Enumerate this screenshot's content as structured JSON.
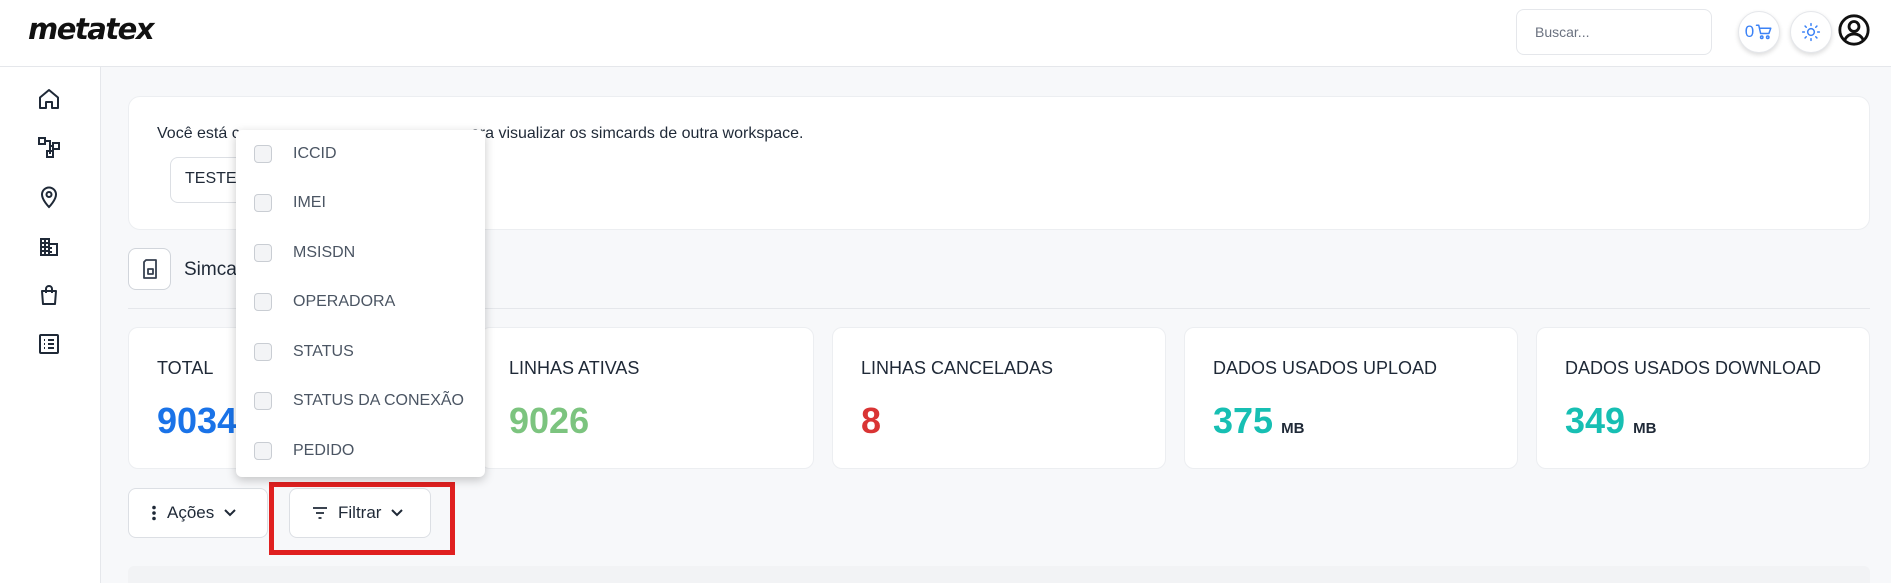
{
  "header": {
    "logo": "metatex",
    "search_placeholder": "Buscar...",
    "cart_count": "0",
    "icons": [
      "cart-icon",
      "sun-icon",
      "user-circle-icon"
    ]
  },
  "sidebar": {
    "icons": [
      "home-icon",
      "hierarchy-icon",
      "location-pin-icon",
      "buildings-icon",
      "shopping-bag-icon",
      "list-icon"
    ]
  },
  "workspace": {
    "message": "Você está c                                                    ara visualizar os simcards de outra workspace.",
    "selected": "TESTE"
  },
  "section": {
    "title": "Simcar",
    "icon": "simcard-icon"
  },
  "stats": [
    {
      "label": "TOTAL",
      "value": "9034",
      "unit": "",
      "color": "#1a73e8"
    },
    {
      "label": "LINHAS ATIVAS",
      "value": "9026",
      "unit": "",
      "color": "#7cc47f"
    },
    {
      "label": "LINHAS CANCELADAS",
      "value": "8",
      "unit": "",
      "color": "#d93434"
    },
    {
      "label": "DADOS USADOS UPLOAD",
      "value": "375",
      "unit": "MB",
      "color": "#17bfb3"
    },
    {
      "label": "DADOS USADOS DOWNLOAD",
      "value": "349",
      "unit": "MB",
      "color": "#17bfb3"
    }
  ],
  "actions": {
    "acoes_label": "Ações",
    "filtrar_label": "Filtrar"
  },
  "filter_dropdown": {
    "items": [
      "ICCID",
      "IMEI",
      "MSISDN",
      "OPERADORA",
      "STATUS",
      "STATUS DA CONEXÃO",
      "PEDIDO"
    ]
  }
}
